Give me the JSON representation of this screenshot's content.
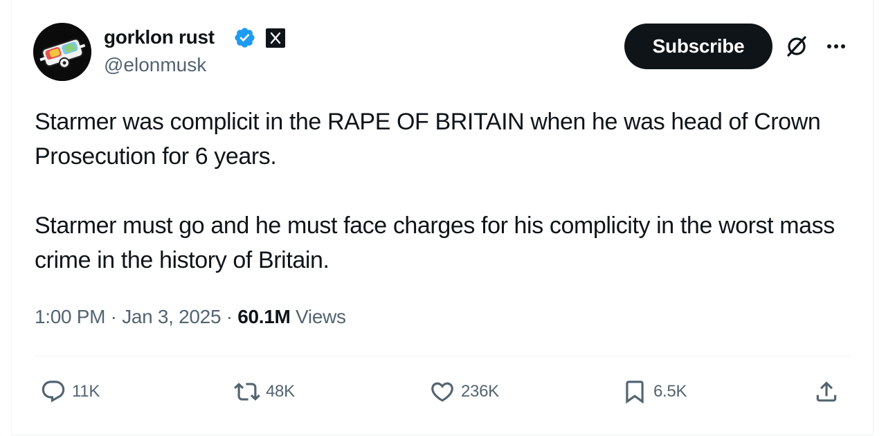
{
  "author": {
    "display_name": "gorklon rust",
    "handle": "@elonmusk",
    "verified_icon": "verified-badge-icon",
    "affiliation_icon": "x-affiliate-icon"
  },
  "header": {
    "subscribe_label": "Subscribe",
    "grok_icon": "grok-icon",
    "more_icon": "more-icon"
  },
  "tweet": {
    "paragraph_1": "Starmer was complicit in the RAPE OF BRITAIN when he was head of Crown Prosecution for 6 years.",
    "paragraph_2": "Starmer must go and he must face charges for his complicity in the worst mass crime in the history of Britain."
  },
  "meta": {
    "time": "1:00 PM",
    "separator": "·",
    "date": "Jan 3, 2025",
    "views_count": "60.1M",
    "views_label": "Views"
  },
  "actions": {
    "replies": "11K",
    "reposts": "48K",
    "likes": "236K",
    "bookmarks": "6.5K"
  },
  "colors": {
    "text_primary": "#0f1419",
    "text_secondary": "#536471",
    "verified_blue": "#1d9bf0",
    "subscribe_bg": "#0f1419",
    "divider": "#eff3f4"
  }
}
